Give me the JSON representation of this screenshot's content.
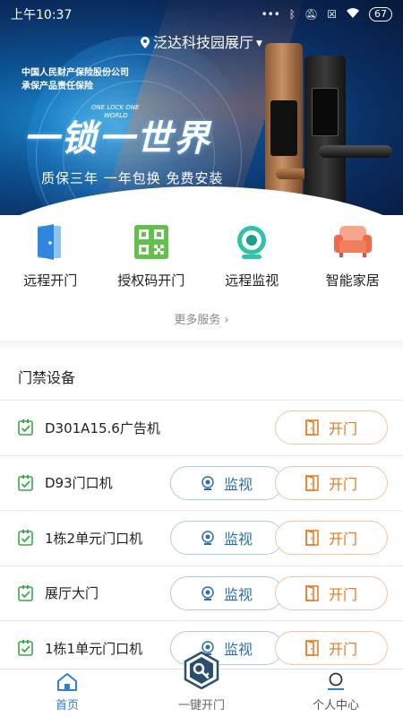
{
  "status_bar": {
    "time": "上午10:37",
    "battery": "67"
  },
  "location": {
    "label": "泛达科技园展厅"
  },
  "banner": {
    "insurer_line1": "中国人民财产保险股份公司",
    "insurer_line2": "承保产品责任保险",
    "slogan": "一锁一世界",
    "slogan_small_line1": "ONE LOCK ONE",
    "slogan_small_line2": "WORLD",
    "tagline": "质保三年 一年包换 免费安装"
  },
  "quick_actions": [
    {
      "label": "远程开门",
      "icon": "door-icon"
    },
    {
      "label": "授权码开门",
      "icon": "qr-code-icon"
    },
    {
      "label": "远程监视",
      "icon": "camera-icon"
    },
    {
      "label": "智能家居",
      "icon": "sofa-icon"
    }
  ],
  "more_services": "更多服务",
  "section_title": "门禁设备",
  "devices": [
    {
      "name": "D301A15.6广告机",
      "has_monitor": false
    },
    {
      "name": "D93门口机",
      "has_monitor": true
    },
    {
      "name": "1栋2单元门口机",
      "has_monitor": true
    },
    {
      "name": "展厅大门",
      "has_monitor": true
    },
    {
      "name": "1栋1单元门口机",
      "has_monitor": true
    }
  ],
  "buttons": {
    "monitor": "监视",
    "open": "开门"
  },
  "bottom_nav": {
    "home": "首页",
    "one_key": "一键开门",
    "me": "个人中心"
  },
  "colors": {
    "accent_blue": "#2f7fd4",
    "open_orange": "#e6771a",
    "monitor_blue": "#2b6fa9",
    "check_green": "#3aa845"
  }
}
